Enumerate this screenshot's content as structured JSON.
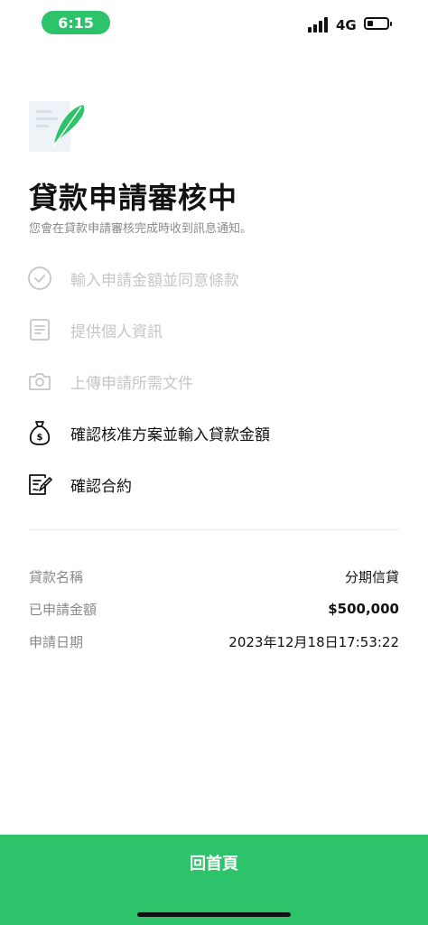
{
  "status_bar": {
    "time": "6:15",
    "network": "4G",
    "battery_level": 0.3
  },
  "page": {
    "title": "貸款申請審核中",
    "subtitle": "您會在貸款申請審核完成時收到訊息通知。"
  },
  "steps": [
    {
      "label": "輸入申請金額並同意條款",
      "state": "done",
      "icon": "check-circle-icon"
    },
    {
      "label": "提供個人資訊",
      "state": "done",
      "icon": "document-icon"
    },
    {
      "label": "上傳申請所需文件",
      "state": "done",
      "icon": "camera-icon"
    },
    {
      "label": "確認核准方案並輸入貸款金額",
      "state": "pending",
      "icon": "money-bag-icon"
    },
    {
      "label": "確認合約",
      "state": "pending",
      "icon": "contract-sign-icon"
    }
  ],
  "details": {
    "loan_name_label": "貸款名稱",
    "loan_name_value": "分期信貸",
    "amount_label": "已申請金額",
    "amount_value": "$500,000",
    "date_label": "申請日期",
    "date_value": "2023年12月18日17:53:22"
  },
  "footer": {
    "home_button_label": "回首頁"
  },
  "colors": {
    "accent": "#2cc36b",
    "muted_text": "#8a8a8a",
    "done_step": "#c6c6c6"
  }
}
